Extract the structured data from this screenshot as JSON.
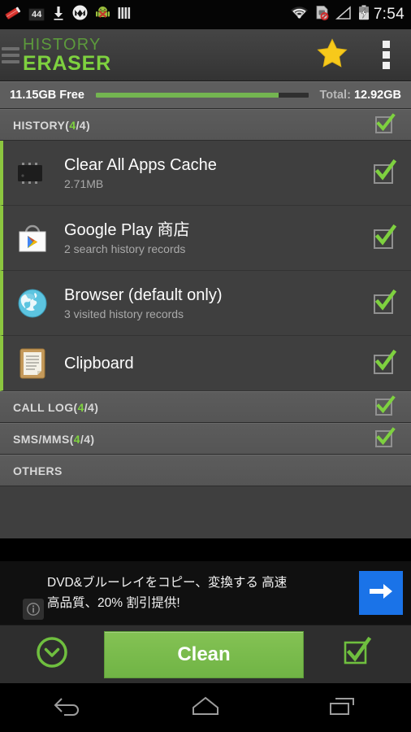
{
  "status_bar": {
    "left_icons": [
      "eraser-icon",
      "notification-count-badge",
      "download-icon",
      "motorola-logo-icon",
      "android-blocked-icon",
      "bars-icon"
    ],
    "notification_count": "44",
    "right_icons": [
      "wifi-icon",
      "sim-card-blocked-icon",
      "signal-icon",
      "battery-charging-icon"
    ],
    "clock": "7:54"
  },
  "action_bar": {
    "app_name_line1": "HISTORY",
    "app_name_line2": "ERASER",
    "star_icon": "star-icon",
    "overflow_icon": "overflow-menu-icon",
    "brand_color": "#7ed13f"
  },
  "storage": {
    "free_label": "11.15GB Free",
    "total_label": "Total:",
    "total_value": "12.92GB",
    "fill_percent": 86,
    "fill_color": "#74b551"
  },
  "groups": [
    {
      "title_prefix": "HISTORY(",
      "title_count": "4",
      "title_suffix": "/4)",
      "checked": true,
      "items": [
        {
          "title": "Clear All Apps Cache",
          "subtitle": "2.71MB",
          "icon": "microchip-icon",
          "checked": true
        },
        {
          "title": "Google Play 商店",
          "subtitle": "2 search history records",
          "icon": "google-play-store-icon",
          "checked": true
        },
        {
          "title": "Browser (default only)",
          "subtitle": "3 visited history records",
          "icon": "globe-browser-icon",
          "checked": true
        },
        {
          "title": "Clipboard",
          "subtitle": "",
          "icon": "clipboard-icon",
          "checked": true
        }
      ]
    },
    {
      "title_prefix": "CALL LOG(",
      "title_count": "4",
      "title_suffix": "/4)",
      "checked": true,
      "items": []
    },
    {
      "title_prefix": "SMS/MMS(",
      "title_count": "4",
      "title_suffix": "/4)",
      "checked": true,
      "items": []
    },
    {
      "title_prefix": "OTHERS",
      "title_count": "",
      "title_suffix": "",
      "checked": false,
      "items": []
    }
  ],
  "ad": {
    "line1": "DVD&ブルーレイをコピー、変換する 高速",
    "line2": "高品質、20% 割引提供!",
    "info_icon": "ad-info-icon",
    "arrow_icon": "arrow-right-icon",
    "arrow_color": "#1a73e8"
  },
  "bottom_bar": {
    "expand_icon": "chevron-down-circle-icon",
    "clean_label": "Clean",
    "select_all_icon": "select-all-checkbox-icon",
    "clean_color": "#78b84a"
  },
  "nav_bar": {
    "back_icon": "back-icon",
    "home_icon": "home-icon",
    "recents_icon": "recents-icon"
  }
}
